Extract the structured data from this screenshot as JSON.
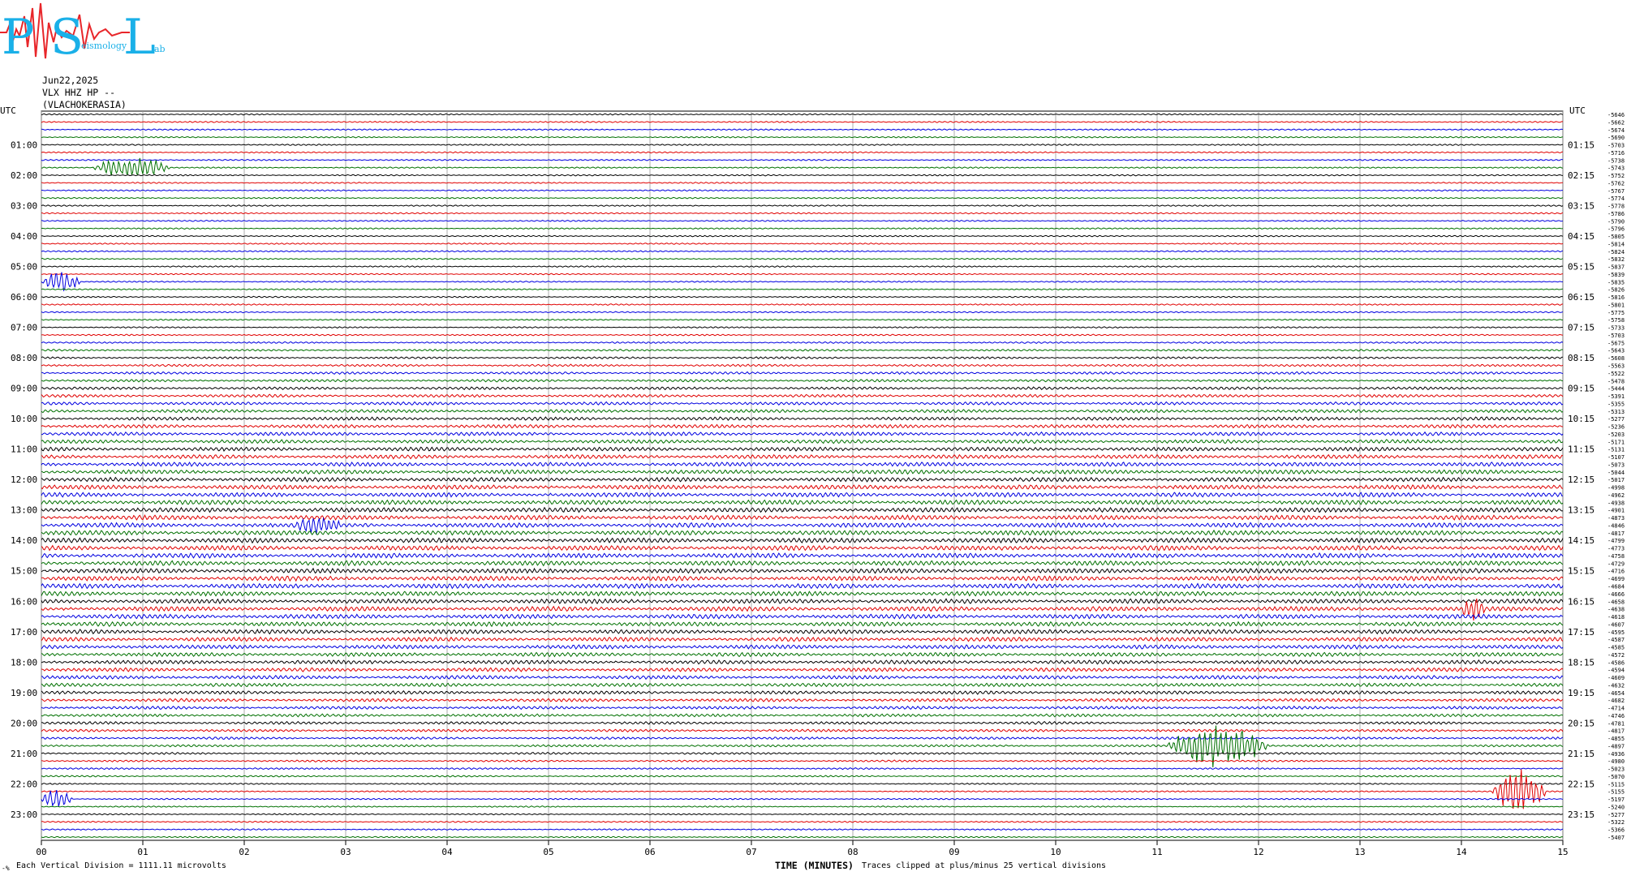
{
  "logo": {
    "big_letters": [
      "P",
      "S",
      "L"
    ],
    "small_text": [
      "eismology",
      "ab"
    ]
  },
  "header": {
    "date": "Jun22,2025",
    "station": "VLX HHZ HP --",
    "location": "(VLACHOKERASIA)"
  },
  "axis": {
    "left_label": "UTC",
    "right_label": "UTC",
    "left_ticks": [
      "01:00",
      "02:00",
      "03:00",
      "04:00",
      "05:00",
      "06:00",
      "07:00",
      "08:00",
      "09:00",
      "10:00",
      "11:00",
      "12:00",
      "13:00",
      "14:00",
      "15:00",
      "16:00",
      "17:00",
      "18:00",
      "19:00",
      "20:00",
      "21:00",
      "22:00",
      "23:00"
    ],
    "right_ticks": [
      "01:15",
      "02:15",
      "03:15",
      "04:15",
      "05:15",
      "06:15",
      "07:15",
      "08:15",
      "09:15",
      "10:15",
      "11:15",
      "12:15",
      "13:15",
      "14:15",
      "15:15",
      "16:15",
      "17:15",
      "18:15",
      "19:15",
      "20:15",
      "21:15",
      "22:15",
      "23:15"
    ],
    "x_ticks": [
      "00",
      "01",
      "02",
      "03",
      "04",
      "05",
      "06",
      "07",
      "08",
      "09",
      "10",
      "11",
      "12",
      "13",
      "14",
      "15"
    ],
    "x_label": "TIME (MINUTES)"
  },
  "footer": {
    "corner_mark": "-%",
    "scale_note": "Each Vertical Division = 1111.11 microvolts",
    "clip_note": "Traces clipped at plus/minus 25 vertical divisions"
  },
  "colors": {
    "trace_cycle": [
      "#000000",
      "#e00000",
      "#0000e0",
      "#007000"
    ],
    "grid": "#999999",
    "logo_red": "#e8262a",
    "logo_cyan": "#1ab0e8"
  },
  "chart_data": {
    "type": "line",
    "subtype": "helicorder",
    "x_range_minutes": [
      0,
      15
    ],
    "rows": 96,
    "row_offsets": [
      "-5646",
      "-5662",
      "-5674",
      "-5690",
      "-5703",
      "-5716",
      "-5738",
      "-5743",
      "-5752",
      "-5762",
      "-5767",
      "-5774",
      "-5778",
      "-5786",
      "-5790",
      "-5796",
      "-5805",
      "-5814",
      "-5824",
      "-5832",
      "-5837",
      "-5839",
      "-5835",
      "-5826",
      "-5816",
      "-5801",
      "-5775",
      "-5758",
      "-5733",
      "-5703",
      "-5675",
      "-5643",
      "-5608",
      "-5563",
      "-5522",
      "-5478",
      "-5444",
      "-5391",
      "-5355",
      "-5313",
      "-5277",
      "-5236",
      "-5203",
      "-5171",
      "-5131",
      "-5107",
      "-5073",
      "-5044",
      "-5017",
      "-4998",
      "-4962",
      "-4938",
      "-4901",
      "-4873",
      "-4846",
      "-4817",
      "-4799",
      "-4773",
      "-4758",
      "-4729",
      "-4716",
      "-4699",
      "-4684",
      "-4666",
      "-4658",
      "-4638",
      "-4618",
      "-4607",
      "-4595",
      "-4587",
      "-4585",
      "-4572",
      "-4586",
      "-4594",
      "-4609",
      "-4632",
      "-4654",
      "-4682",
      "-4714",
      "-4746",
      "-4781",
      "-4817",
      "-4855",
      "-4897",
      "-4936",
      "-4980",
      "-5023",
      "-5070",
      "-5115",
      "-5155",
      "-5197",
      "-5240",
      "-5277",
      "-5322",
      "-5366",
      "-5407"
    ],
    "events": [
      {
        "row": 7,
        "start_min": 0.5,
        "end_min": 1.5,
        "color": "black",
        "amplitude": "medium"
      },
      {
        "row": 22,
        "start_min": 0.0,
        "end_min": 0.5,
        "color": "blue",
        "amplitude": "medium"
      },
      {
        "row": 54,
        "start_min": 2.5,
        "end_min": 3.1,
        "color": "blue",
        "amplitude": "small"
      },
      {
        "row": 65,
        "start_min": 14.0,
        "end_min": 14.3,
        "color": "red",
        "amplitude": "medium"
      },
      {
        "row": 83,
        "start_min": 11.1,
        "end_min": 12.4,
        "color": "green",
        "amplitude": "large"
      },
      {
        "row": 89,
        "start_min": 14.3,
        "end_min": 15.0,
        "color": "red",
        "amplitude": "large"
      },
      {
        "row": 90,
        "start_min": 0.0,
        "end_min": 0.4,
        "color": "blue",
        "amplitude": "medium"
      }
    ]
  }
}
